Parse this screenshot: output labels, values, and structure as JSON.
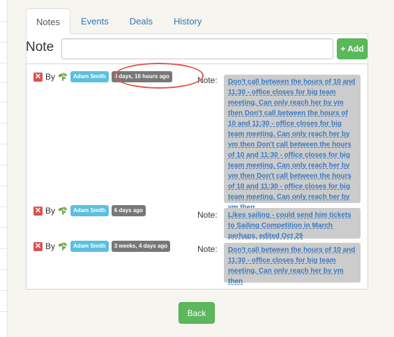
{
  "tabs": [
    {
      "label": "Notes",
      "active": true
    },
    {
      "label": "Events",
      "active": false
    },
    {
      "label": "Deals",
      "active": false
    },
    {
      "label": "History",
      "active": false
    }
  ],
  "note_form": {
    "label": "Note",
    "input_value": "",
    "add_label": "+ Add"
  },
  "notes": [
    {
      "by_label": "By",
      "user": "Adam Smith",
      "time": "4 days, 16 hours ago",
      "note_label": "Note:",
      "text": "Don't call between the hours of 10 and 11:30 - office closes for big team meeting. Can only reach her by vm then Don't call between the hours of 10 and 11:30 - office closes for big team meeting. Can only reach her by vm then Don't call between the hours of 10 and 11:30 - office closes for big team meeting. Can only reach her by vm then Don't call between the hours of 10 and 11:30 - office closes for big team meeting. Can only reach her by vm then"
    },
    {
      "by_label": "By",
      "user": "Adam Smith",
      "time": "6 days ago",
      "note_label": "Note:",
      "text": "Likes sailing - could send him tickets to Sailing Competition in March perhaps. edited Oct 29"
    },
    {
      "by_label": "By",
      "user": "Adam Smith",
      "time": "3 weeks, 4 days ago",
      "note_label": "Note:",
      "text": "Don't call between the hours of 10 and 11:30 - office closes for big team meeting. Can only reach her by vm then"
    }
  ],
  "back_label": "Back",
  "colors": {
    "primary_green": "#5cb85c",
    "user_badge": "#5bc0de",
    "time_badge": "#777777",
    "link": "#3a7ac2",
    "highlight": "#e2574c",
    "delete": "#d9534f"
  },
  "icons": [
    "delete-icon",
    "sprout-icon",
    "plus-icon"
  ]
}
